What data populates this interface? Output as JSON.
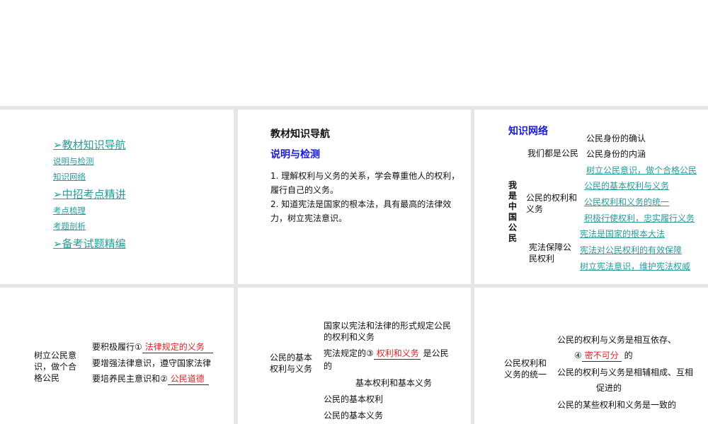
{
  "slide1": {
    "items": [
      {
        "label": "教材知识导航",
        "level": 1
      },
      {
        "label": "说明与检测",
        "level": 2
      },
      {
        "label": "知识网络",
        "level": 2
      },
      {
        "label": "中招考点精讲",
        "level": 1
      },
      {
        "label": "考点梳理",
        "level": 2
      },
      {
        "label": "考题剖析",
        "level": 2
      },
      {
        "label": "备考试题精编",
        "level": 1
      }
    ],
    "bullet": "➢"
  },
  "slide2": {
    "title": "教材知识导航",
    "subtitle": "说明与检测",
    "p1a": "1. 理解权利与义务的关系，学会尊重他人的权利，",
    "p1b": "履行自己的义务。",
    "p2a": "2. 知道宪法是国家的根本法，具有最高的法律效",
    "p2b": "力，树立宪法意识。"
  },
  "slide3": {
    "title": "知识网络",
    "root": "我是中国公民",
    "b1": "我们都是公民",
    "b1a": "公民身份的确认",
    "b1b": "公民身份的内涵",
    "b2": "公民的权利和义务",
    "b2a": "树立公民意识，做个合格公民",
    "b2b": "公民的基本权利与义务",
    "b2c": "公民权利和义务的统一",
    "b2d": "积极行使权利，忠实履行义务",
    "b3": "宪法保障公民权利",
    "b3a": "宪法是国家的根本大法",
    "b3b": "宪法对公民权利的有效保障",
    "b3c": "树立宪法意识，维护宪法权威"
  },
  "slide4": {
    "head": "树立公民意识，做个合格公民",
    "l1": "要积极履行①",
    "a1": "法律规定的义务",
    "l2": "要增强法律意识，遵守国家法律",
    "l3": "要培养民主意识和②",
    "a2": "公民道德"
  },
  "slide5": {
    "head": "公民的基本权利与义务",
    "l1": "国家以宪法和法律的形式规定公民的权利和义务",
    "l2": "宪法规定的③",
    "a3": "权利和义务",
    "l2b": "是公民",
    "l2c": "的",
    "l3": "基本权利和基本义务",
    "l4": "公民的基本权利",
    "l5": "公民的基本义务"
  },
  "slide6": {
    "head": "公民权利和义务的统一",
    "l1": "公民的权利与义务是相互依存、",
    "l2a": "④",
    "a4": "密不可分",
    "l2b": "的",
    "l3": "公民的权利与义务是相辅相成、互相",
    "l3b": "促进的",
    "l4": "公民的某些权利和义务是一致的"
  }
}
